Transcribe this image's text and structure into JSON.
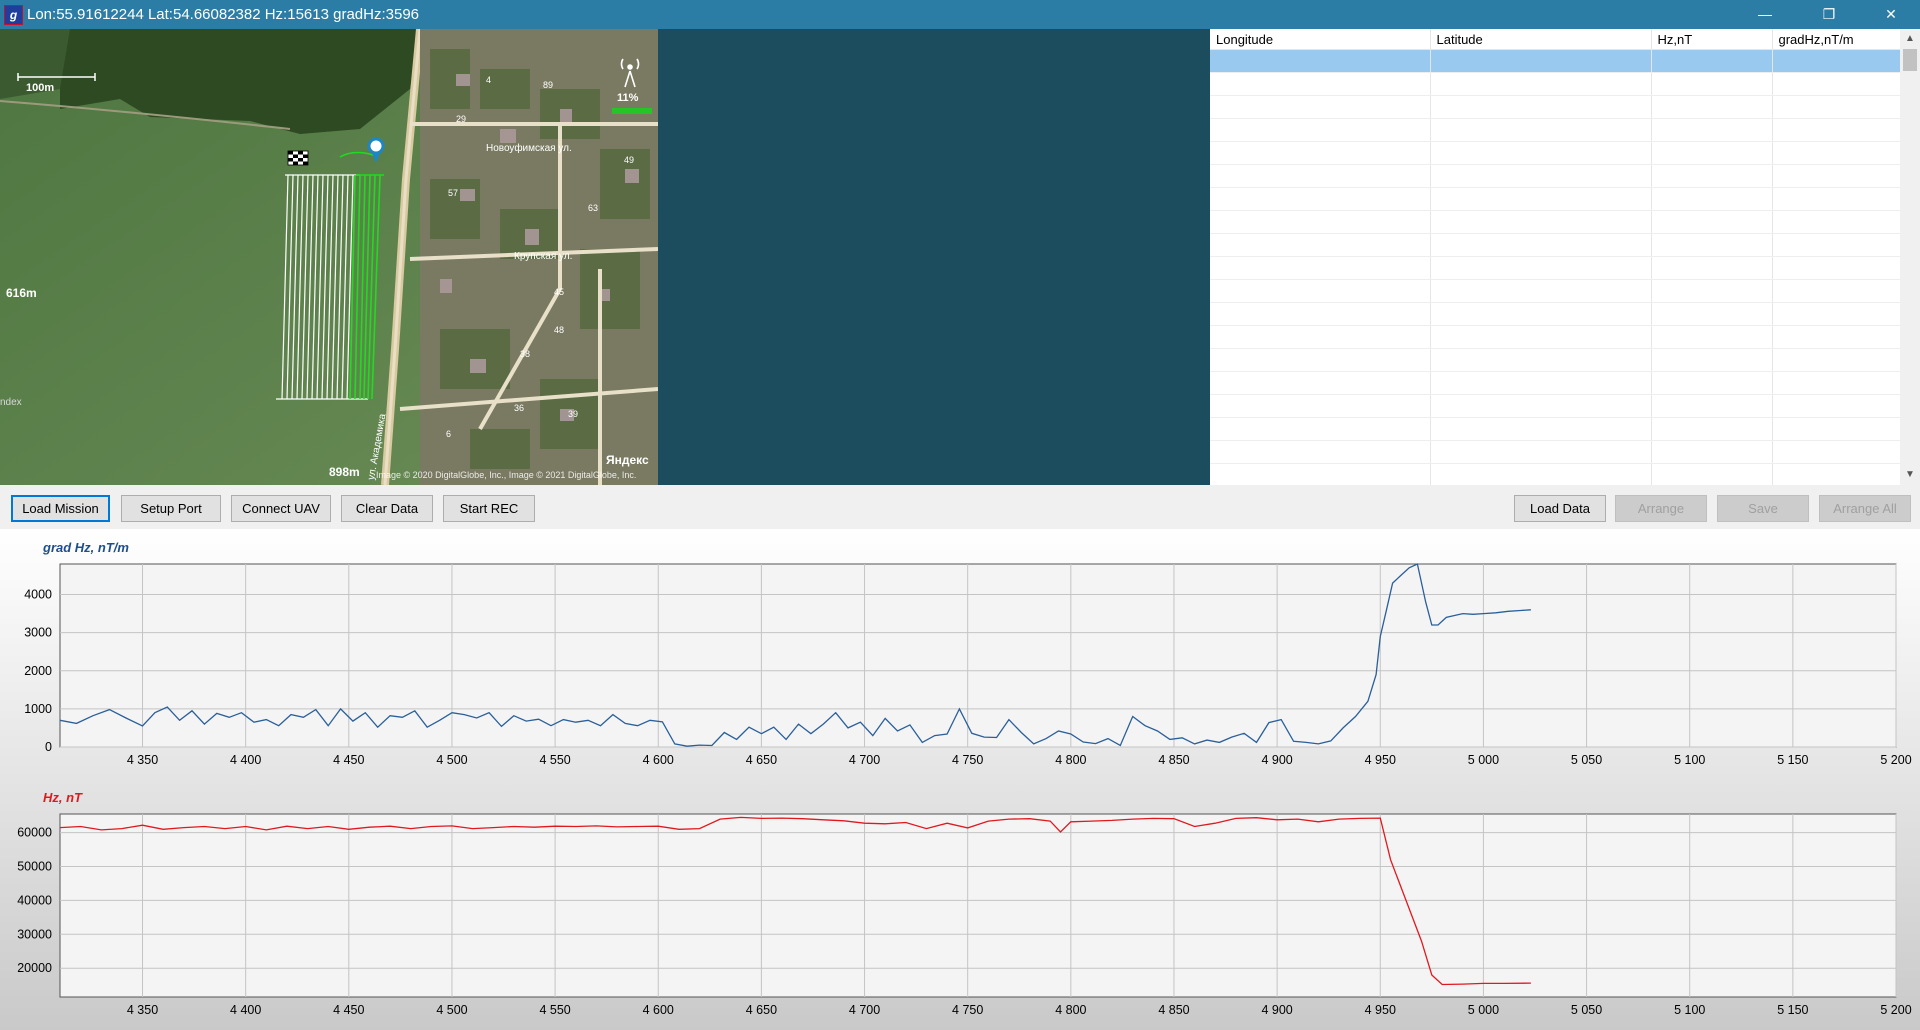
{
  "window": {
    "title": "Lon:55.91612244 Lat:54.66082382 Hz:15613 gradHz:3596",
    "app_icon": "g",
    "minimize_glyph": "—",
    "restore_glyph": "❐",
    "close_glyph": "✕"
  },
  "map": {
    "scale_label": "100m",
    "side_distance": "616m",
    "bottom_distance": "898m",
    "copyright": "Image © 2020 DigitalGlobe, Inc., Image © 2021 DigitalGlobe, Inc.",
    "provider": "Яндекс",
    "left_watermark": "ndex",
    "signal_label": "11%",
    "street_1": "Новоуфимская ул.",
    "street_2": "Крупская ул.",
    "street_3": "ул. Академика",
    "house_numbers": [
      "4",
      "89",
      "29",
      "49",
      "57",
      "63",
      "45",
      "48",
      "38",
      "36",
      "39",
      "6"
    ]
  },
  "grid": {
    "columns": [
      "Longitude",
      "Latitude",
      "Hz,nT",
      "gradHz,nT/m"
    ],
    "rows": []
  },
  "toolbar": {
    "load_mission": "Load Mission",
    "setup_port": "Setup Port",
    "connect_uav": "Connect UAV",
    "clear_data": "Clear Data",
    "start_rec": "Start REC",
    "load_data": "Load Data",
    "arrange": "Arrange",
    "save": "Save",
    "arrange_all": "Arrange All"
  },
  "chart_data": [
    {
      "type": "line",
      "title": "grad Hz, nT/m",
      "color": "#2a5f9a",
      "xlim": [
        4310,
        5200
      ],
      "ylim": [
        0,
        4800
      ],
      "xticks": [
        4350,
        4400,
        4450,
        4500,
        4550,
        4600,
        4650,
        4700,
        4750,
        4800,
        4850,
        4900,
        4950,
        5000,
        5050,
        5100,
        5150,
        5200
      ],
      "xtick_labels": [
        "4 350",
        "4 400",
        "4 450",
        "4 500",
        "4 550",
        "4 600",
        "4 650",
        "4 700",
        "4 750",
        "4 800",
        "4 850",
        "4 900",
        "4 950",
        "5 000",
        "5 050",
        "5 100",
        "5 150",
        "5 200"
      ],
      "yticks": [
        0,
        1000,
        2000,
        3000,
        4000
      ],
      "series": [
        {
          "x": [
            4310,
            4318,
            4326,
            4334,
            4342,
            4350,
            4356,
            4362,
            4368,
            4374,
            4380,
            4386,
            4392,
            4398,
            4404,
            4410,
            4416,
            4422,
            4428,
            4434,
            4440,
            4446,
            4452,
            4458,
            4464,
            4470,
            4476,
            4482,
            4488,
            4494,
            4500,
            4506,
            4512,
            4518,
            4524,
            4530,
            4536,
            4542,
            4548,
            4554,
            4560,
            4566,
            4572,
            4578,
            4584,
            4590,
            4596,
            4602,
            4608,
            4614,
            4620,
            4626,
            4632,
            4638,
            4644,
            4650,
            4656,
            4662,
            4668,
            4674,
            4680,
            4686,
            4692,
            4698,
            4704,
            4710,
            4716,
            4722,
            4728,
            4734,
            4740,
            4746,
            4752,
            4758,
            4764,
            4770,
            4776,
            4782,
            4788,
            4794,
            4800,
            4806,
            4812,
            4818,
            4824,
            4830,
            4836,
            4842,
            4848,
            4854,
            4860,
            4866,
            4872,
            4878,
            4884,
            4890,
            4896,
            4902,
            4908,
            4914,
            4920,
            4926,
            4932,
            4938,
            4944,
            4948,
            4950,
            4953,
            4956,
            4960,
            4964,
            4968,
            4972,
            4975,
            4978,
            4982,
            4986,
            4990,
            4995,
            5000,
            5006,
            5012,
            5018,
            5023
          ],
          "y": [
            700,
            620,
            820,
            980,
            760,
            550,
            900,
            1050,
            700,
            950,
            600,
            880,
            780,
            900,
            650,
            720,
            560,
            850,
            780,
            980,
            560,
            1000,
            680,
            900,
            520,
            820,
            780,
            950,
            520,
            700,
            900,
            850,
            760,
            900,
            540,
            820,
            680,
            730,
            560,
            720,
            650,
            700,
            560,
            850,
            620,
            560,
            700,
            660,
            80,
            20,
            50,
            40,
            380,
            200,
            520,
            350,
            520,
            200,
            600,
            350,
            600,
            900,
            500,
            650,
            300,
            750,
            420,
            580,
            120,
            300,
            340,
            1000,
            360,
            260,
            250,
            720,
            380,
            80,
            220,
            420,
            340,
            130,
            90,
            220,
            40,
            800,
            560,
            420,
            200,
            240,
            80,
            180,
            120,
            260,
            360,
            120,
            640,
            720,
            150,
            120,
            80,
            160,
            500,
            800,
            1200,
            1900,
            2900,
            3600,
            4300,
            4500,
            4700,
            4800,
            3800,
            3200,
            3200,
            3400,
            3450,
            3500,
            3480,
            3500,
            3520,
            3560,
            3580,
            3600
          ]
        }
      ]
    },
    {
      "type": "line",
      "title": "Hz, nT",
      "color": "#e0191e",
      "xlim": [
        4310,
        5200
      ],
      "ylim": [
        11500,
        65500
      ],
      "xticks": [
        4350,
        4400,
        4450,
        4500,
        4550,
        4600,
        4650,
        4700,
        4750,
        4800,
        4850,
        4900,
        4950,
        5000,
        5050,
        5100,
        5150,
        5200
      ],
      "xtick_labels": [
        "4 350",
        "4 400",
        "4 450",
        "4 500",
        "4 550",
        "4 600",
        "4 650",
        "4 700",
        "4 750",
        "4 800",
        "4 850",
        "4 900",
        "4 950",
        "5 000",
        "5 050",
        "5 100",
        "5 150",
        "5 200"
      ],
      "yticks": [
        20000,
        30000,
        40000,
        50000,
        60000
      ],
      "series": [
        {
          "x": [
            4310,
            4320,
            4330,
            4340,
            4350,
            4360,
            4370,
            4380,
            4390,
            4400,
            4410,
            4420,
            4430,
            4440,
            4450,
            4460,
            4470,
            4480,
            4490,
            4500,
            4510,
            4520,
            4530,
            4540,
            4550,
            4560,
            4570,
            4580,
            4590,
            4600,
            4610,
            4620,
            4630,
            4640,
            4650,
            4660,
            4670,
            4680,
            4690,
            4700,
            4710,
            4720,
            4730,
            4740,
            4750,
            4760,
            4770,
            4780,
            4790,
            4795,
            4800,
            4810,
            4820,
            4830,
            4840,
            4850,
            4860,
            4870,
            4880,
            4890,
            4900,
            4910,
            4920,
            4930,
            4940,
            4950,
            4955,
            4960,
            4965,
            4970,
            4975,
            4980,
            4990,
            5000,
            5010,
            5023
          ],
          "y": [
            61500,
            61800,
            60800,
            61200,
            62200,
            61000,
            61500,
            61800,
            61200,
            61800,
            60800,
            61900,
            61200,
            61800,
            61000,
            61600,
            61900,
            61200,
            61800,
            62000,
            61200,
            61500,
            61800,
            61600,
            61900,
            61800,
            62000,
            61700,
            61800,
            61900,
            61000,
            61200,
            64000,
            64500,
            64200,
            64300,
            64100,
            63800,
            63500,
            62800,
            62600,
            63000,
            61200,
            62800,
            61400,
            63400,
            64000,
            64100,
            63400,
            60200,
            63200,
            63400,
            63600,
            64000,
            64200,
            64100,
            61800,
            62800,
            64200,
            64400,
            63800,
            64000,
            63200,
            64000,
            64200,
            64300,
            52000,
            44000,
            36000,
            28000,
            18000,
            15200,
            15300,
            15500,
            15500,
            15600
          ]
        }
      ]
    }
  ]
}
